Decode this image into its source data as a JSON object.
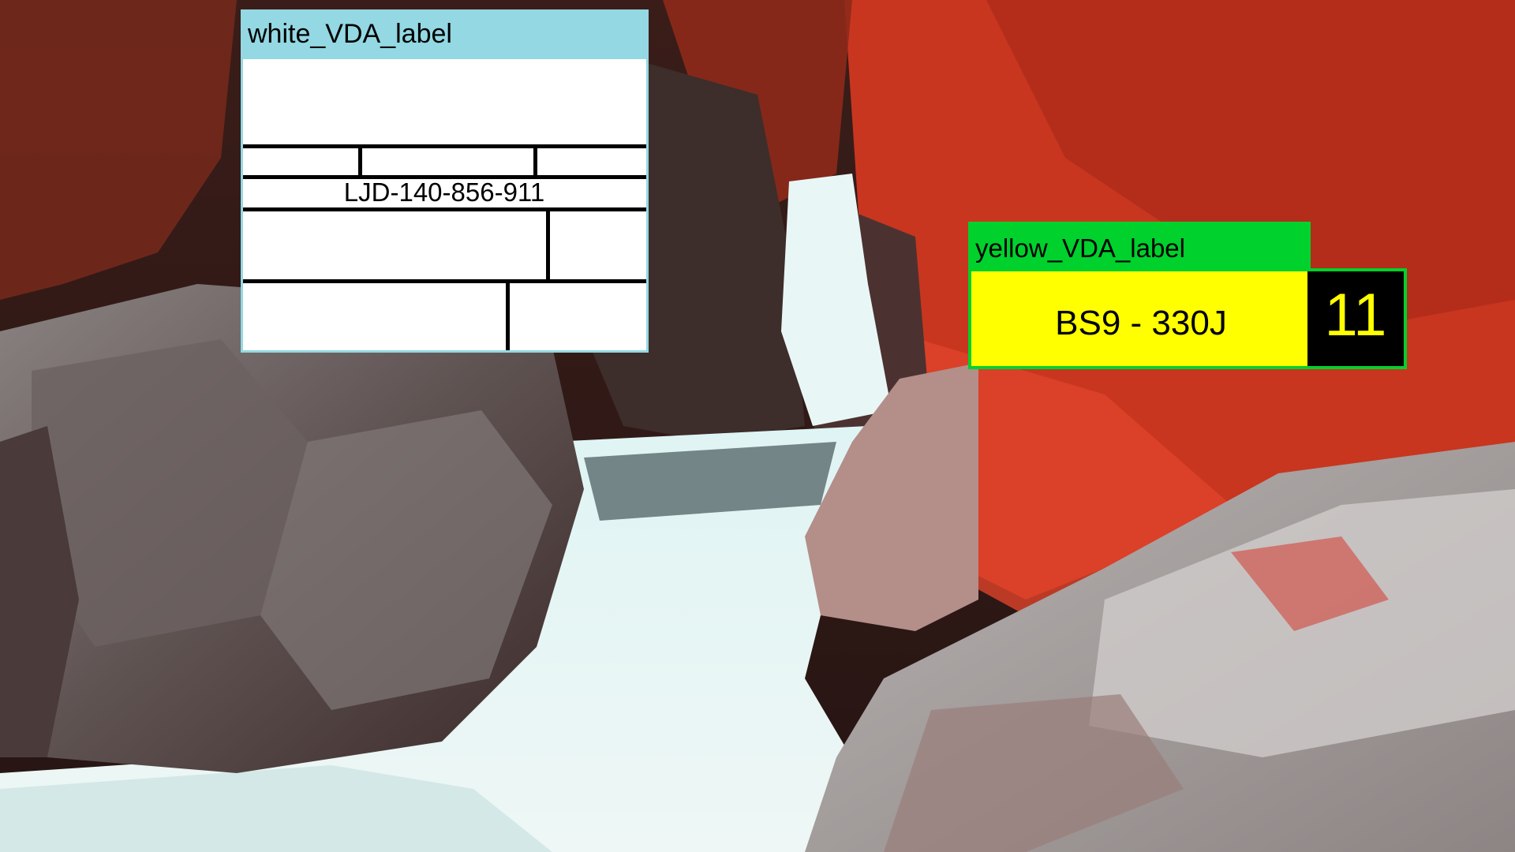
{
  "white_label": {
    "title": "white_VDA_label",
    "code": "LJD-140-856-911"
  },
  "yellow_label": {
    "title": "yellow_VDA_label",
    "plate": "BS9 - 330J",
    "number": "11"
  },
  "colors": {
    "white_label_frame": "#93d8e2",
    "yellow_label_frame": "#00d12d",
    "yellow_fill": "#ffff00",
    "number_box": "#000000"
  }
}
